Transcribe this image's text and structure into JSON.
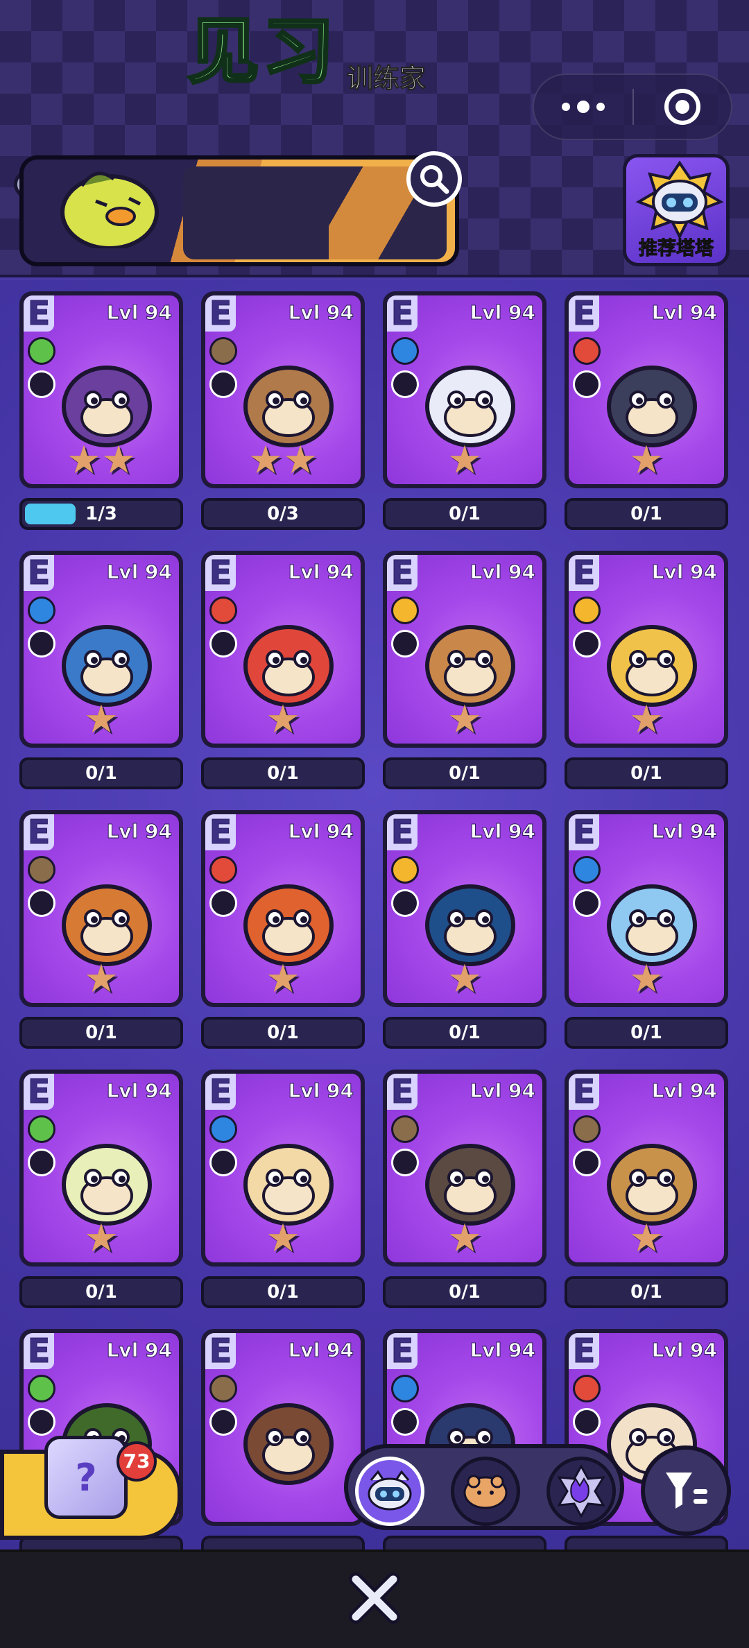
{
  "header": {
    "banner_title": "见习",
    "banner_subtitle": "训练家",
    "recommend_label": "推荐塔塔"
  },
  "cards": [
    {
      "grade": "E",
      "level": "Lvl 94",
      "element": "grass",
      "role": "hourglass",
      "stars": "★★",
      "count": "1/3",
      "progress": 0.33,
      "pet": "mushroom"
    },
    {
      "grade": "E",
      "level": "Lvl 94",
      "element": "earth",
      "role": "shield",
      "stars": "★★",
      "count": "0/3",
      "progress": 0,
      "pet": "bear"
    },
    {
      "grade": "E",
      "level": "Lvl 94",
      "element": "water",
      "role": "sword",
      "stars": "★",
      "count": "0/1",
      "progress": 0,
      "pet": "robot-cat"
    },
    {
      "grade": "E",
      "level": "Lvl 94",
      "element": "fire",
      "role": "feather",
      "stars": "★",
      "count": "0/1",
      "progress": 0,
      "pet": "husky"
    },
    {
      "grade": "E",
      "level": "Lvl 94",
      "element": "water",
      "role": "sword",
      "stars": "★",
      "count": "0/1",
      "progress": 0,
      "pet": "seal-ball"
    },
    {
      "grade": "E",
      "level": "Lvl 94",
      "element": "fire",
      "role": "sword",
      "stars": "★",
      "count": "0/1",
      "progress": 0,
      "pet": "salamander"
    },
    {
      "grade": "E",
      "level": "Lvl 94",
      "element": "elec",
      "role": "sword",
      "stars": "★",
      "count": "0/1",
      "progress": 0,
      "pet": "deer"
    },
    {
      "grade": "E",
      "level": "Lvl 94",
      "element": "elec",
      "role": "feather",
      "stars": "★",
      "count": "0/1",
      "progress": 0,
      "pet": "fox"
    },
    {
      "grade": "E",
      "level": "Lvl 94",
      "element": "earth",
      "role": "feather",
      "stars": "★",
      "count": "0/1",
      "progress": 0,
      "pet": "kangaroo"
    },
    {
      "grade": "E",
      "level": "Lvl 94",
      "element": "fire",
      "role": "diamond",
      "stars": "★",
      "count": "0/1",
      "progress": 0,
      "pet": "tiger"
    },
    {
      "grade": "E",
      "level": "Lvl 94",
      "element": "elec",
      "role": "sword",
      "stars": "★",
      "count": "0/1",
      "progress": 0,
      "pet": "cloud-whale"
    },
    {
      "grade": "E",
      "level": "Lvl 94",
      "element": "water",
      "role": "flask",
      "stars": "★",
      "count": "0/1",
      "progress": 0,
      "pet": "axolotl"
    },
    {
      "grade": "E",
      "level": "Lvl 94",
      "element": "grass",
      "role": "sword",
      "stars": "★",
      "count": "0/1",
      "progress": 0,
      "pet": "sprout-duck"
    },
    {
      "grade": "E",
      "level": "Lvl 94",
      "element": "water",
      "role": "flask",
      "stars": "★",
      "count": "0/1",
      "progress": 0,
      "pet": "fish-boy"
    },
    {
      "grade": "E",
      "level": "Lvl 94",
      "element": "earth",
      "role": "flask",
      "stars": "★",
      "count": "0/1",
      "progress": 0,
      "pet": "raccoon"
    },
    {
      "grade": "E",
      "level": "Lvl 94",
      "element": "earth",
      "role": "feather",
      "stars": "★",
      "count": "0/1",
      "progress": 0,
      "pet": "turtle"
    },
    {
      "grade": "E",
      "level": "Lvl 94",
      "element": "grass",
      "role": "diamond",
      "stars": "",
      "count": "",
      "progress": 0,
      "pet": "turtle-shell"
    },
    {
      "grade": "E",
      "level": "Lvl 94",
      "element": "earth",
      "role": "feather",
      "stars": "",
      "count": "",
      "progress": 0,
      "pet": "monkey"
    },
    {
      "grade": "E",
      "level": "Lvl 94",
      "element": "water",
      "role": "shield",
      "stars": "",
      "count": "",
      "progress": 0,
      "pet": "penguin"
    },
    {
      "grade": "E",
      "level": "Lvl 94",
      "element": "fire",
      "role": "plus",
      "stars": "",
      "count": "",
      "progress": 0,
      "pet": "chicken"
    }
  ],
  "dice": {
    "count": "73",
    "symbol": "?"
  },
  "colors": {
    "card_bg": "#a548ea",
    "grade_bg": "#d9d3ff",
    "progress_fill": "#4fc8f0",
    "badge_red": "#e23e3a",
    "banner_title": "#8ef08a"
  }
}
